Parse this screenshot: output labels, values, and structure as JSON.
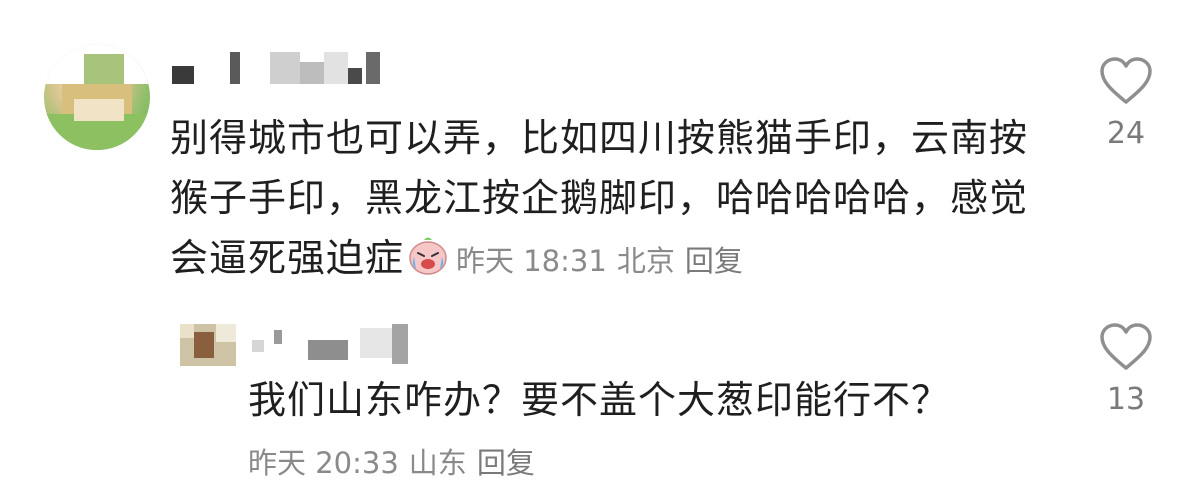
{
  "comment": {
    "text": "别得城市也可以弄，比如四川按熊猫手印，云南按猴子手印，黑龙江按企鹅脚印，哈哈哈哈哈，感觉会逼死强迫症",
    "emoji": "crying-laugh-emoji",
    "time": "昨天 18:31",
    "location": "北京",
    "reply_label": "回复",
    "like_count": "24"
  },
  "reply": {
    "text": "我们山东咋办？要不盖个大葱印能行不？",
    "time": "昨天 20:33",
    "location": "山东",
    "reply_label": "回复",
    "like_count": "13"
  }
}
